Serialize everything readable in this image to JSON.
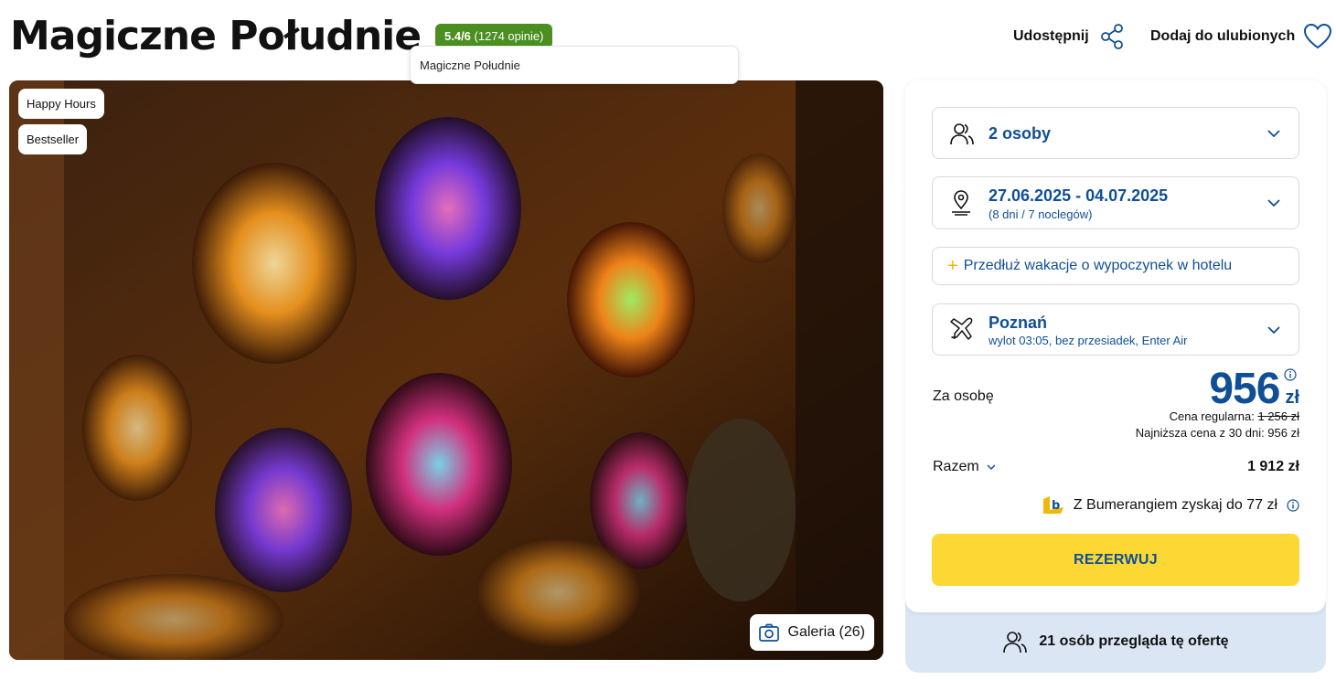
{
  "header": {
    "title": "Magiczne Południe",
    "rating_score": "5.4/6",
    "rating_reviews": "(1274 opinie)",
    "tooltip": "Magiczne Południe",
    "share_label": "Udostępnij",
    "favorite_label": "Dodaj do ulubionych"
  },
  "photo": {
    "badges": [
      "Happy Hours",
      "Bestseller"
    ],
    "gallery_label": "Galeria (26)"
  },
  "booking": {
    "persons": "2 osoby",
    "dates": "27.06.2025 - 04.07.2025",
    "dates_sub": "(8 dni / 7 noclegów)",
    "extend_label": "Przedłuż wakacje o wypoczynek w hotelu",
    "departure_city": "Poznań",
    "departure_sub": "wylot 03:05, bez przesiadek, Enter Air",
    "per_person_label": "Za osobę",
    "price": "956",
    "currency": "zł",
    "regular_label": "Cena regularna:",
    "regular_price": "1 256 zł",
    "lowest_30": "Najniższa cena z 30 dni: 956 zł",
    "total_label": "Razem",
    "total_value": "1 912 zł",
    "bumerang_text": "Z Bumerangiem zyskaj do 77 zł",
    "reserve_label": "REZERWUJ",
    "viewers": "21 osób przegląda tę ofertę"
  },
  "colors": {
    "brand_blue": "#0f4f96",
    "rating_green": "#4a8f1f",
    "reserve_yellow": "#fdd835",
    "panel_footer": "#dbe6f4"
  }
}
